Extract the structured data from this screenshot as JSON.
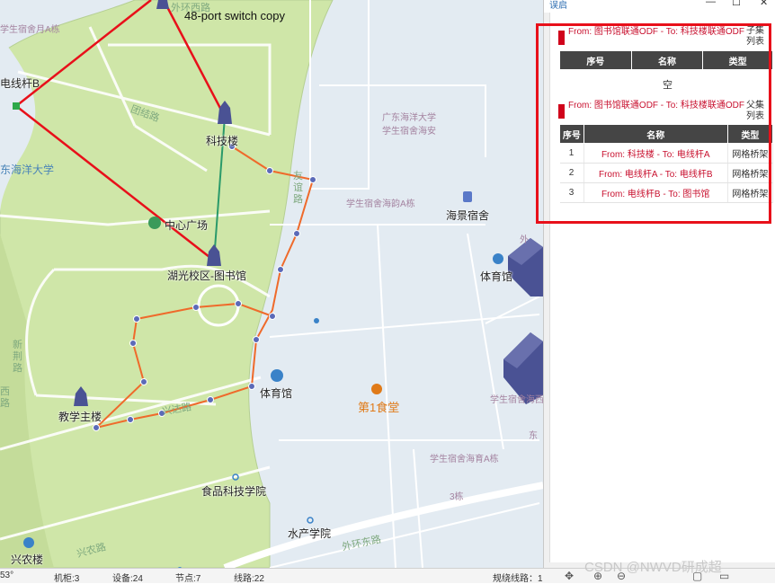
{
  "map": {
    "labels": {
      "switch": "48-port switch copy",
      "pole_b": "电线杆B",
      "ocean_univ_left": "东海洋大学",
      "building_top_left": "学生宿舍月A栋",
      "ring_road_top": "外环西路",
      "tech_building": "科技楼",
      "tuanjie_road": "团结路",
      "central_plaza": "中心广场",
      "library": "湖光校区-图书馆",
      "teaching_building": "教学主楼",
      "xingnong_building": "兴农楼",
      "gymnasium": "体育馆",
      "gym_right": "体育馆",
      "canteen": "第1食堂",
      "food_school": "食品科技学院",
      "fishery_school": "水产学院",
      "ring_road_bottom": "外环东路",
      "haijing_dorm": "海景宿舍",
      "gdocean_dorm": "广东海洋大学\n学生宿舍海安",
      "dorm_haiqiao": "学生宿舍海韵A栋",
      "dorm_haixi": "学生宿舍海西",
      "dorm_haiyu": "学生宿舍海育A栋",
      "building_3": "3栋",
      "xingnong_road": "兴农路",
      "road_left": "新\n荆\n路",
      "road_mid": "友\n谊\n路",
      "road_far_left": "西\n路",
      "xingda_road": "兴达路",
      "outer": "东\n环",
      "label_6": "外",
      "label_dong": "东"
    }
  },
  "status_bar": {
    "coord": "53°",
    "cabinets": "机柜:3",
    "devices": "设备:24",
    "nodes": "节点:7",
    "lines": "线路:22",
    "wiring": "规绕线路：1"
  },
  "panel": {
    "title": "误启",
    "minimize": "—",
    "maximize": "☐",
    "close": "✕",
    "section1": {
      "title": "From: 图书馆联通ODF - To: 科技楼联通ODF",
      "tag": "子集列表",
      "columns": [
        "序号",
        "名称",
        "类型"
      ],
      "empty_text": "空"
    },
    "section2": {
      "title": "From: 图书馆联通ODF - To: 科技楼联通ODF",
      "tag": "父集列表",
      "columns": [
        "序号",
        "名称",
        "类型"
      ],
      "rows": [
        {
          "index": "1",
          "name": "From: 科技楼 - To: 电线杆A",
          "type": "网格桥架"
        },
        {
          "index": "2",
          "name": "From: 电线杆A - To: 电线杆B",
          "type": "网格桥架"
        },
        {
          "index": "3",
          "name": "From: 电线杆B - To: 图书馆",
          "type": "网格桥架"
        }
      ]
    }
  },
  "watermark": "CSDN @NWVD研成超",
  "colors": {
    "highlight": "#e8101a",
    "route_red": "#e8101a",
    "route_orange": "#ef6a2b",
    "route_green": "#2a9a6a",
    "campus_green": "#cfe6a8",
    "water": "#e3ebf2",
    "table_header": "#454545",
    "link_text": "#c8102e"
  }
}
